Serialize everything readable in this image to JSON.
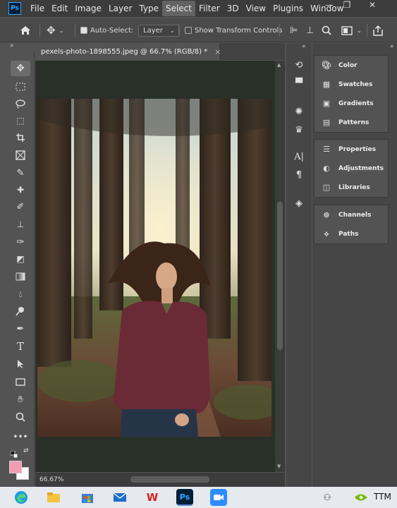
{
  "menu": {
    "logo": "Ps",
    "items": [
      "File",
      "Edit",
      "Image",
      "Layer",
      "Type",
      "Select",
      "Filter",
      "3D",
      "View",
      "Plugins",
      "Window"
    ],
    "active_index": 5,
    "minimize": "—",
    "restore": "❐",
    "close": "✕"
  },
  "options": {
    "auto_select_label": "Auto-Select:",
    "auto_select_checked": true,
    "layer_dropdown": "Layer",
    "show_transform_label": "Show Transform Controls",
    "show_transform_checked": false
  },
  "document": {
    "tab_title": "pexels-photo-1898555.jpeg @ 66.7% (RGB/8) *",
    "tab_close": "×",
    "zoom": "66.67%"
  },
  "panels": {
    "group1": [
      "Color",
      "Swatches",
      "Gradients",
      "Patterns"
    ],
    "group2": [
      "Properties",
      "Adjustments",
      "Libraries"
    ],
    "group3": [
      "Channels",
      "Paths"
    ]
  },
  "taskbar": {
    "tray_text": "TTM"
  },
  "colors": {
    "foreground": "#f39cb3",
    "background": "#ffffff",
    "menu_bg": "#3c3c3c",
    "panel_bg": "#535353",
    "accent": "#31a8ff"
  }
}
